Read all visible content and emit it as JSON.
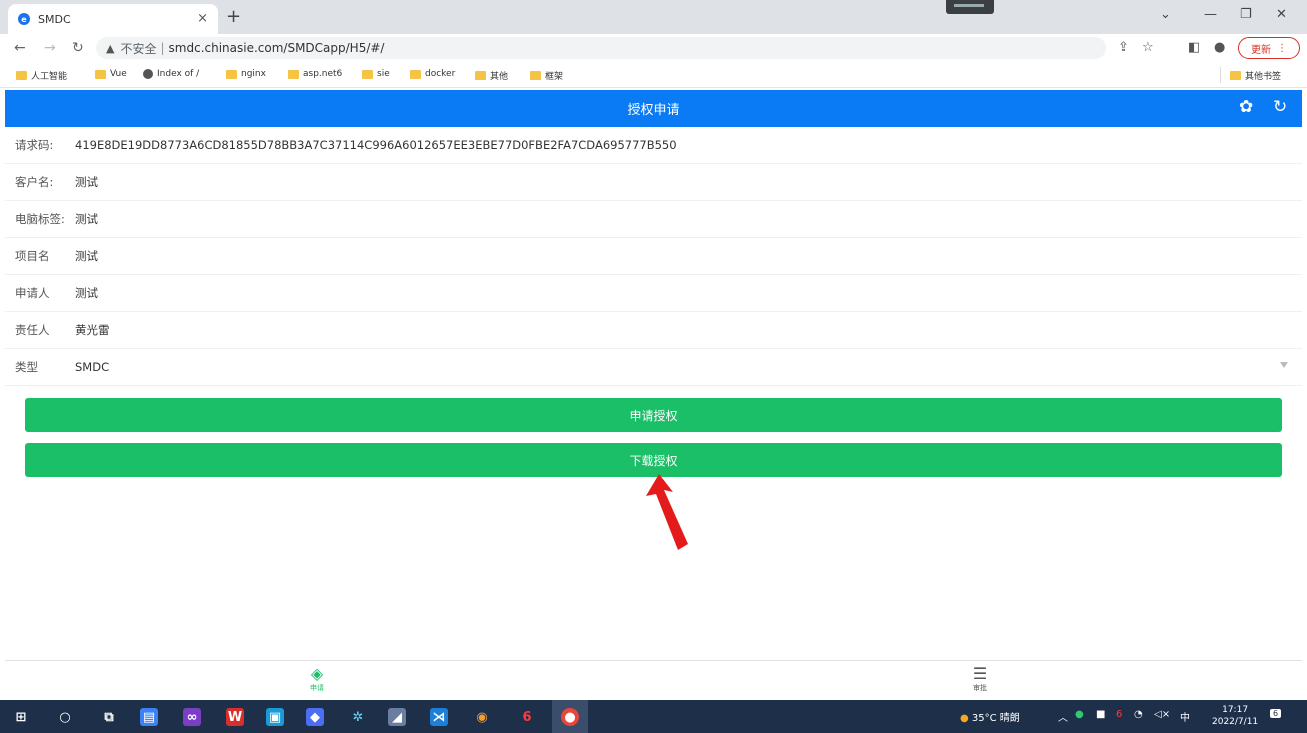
{
  "browser": {
    "tab_title": "SMDC",
    "tab_close": "×",
    "new_tab": "+",
    "win_minimize": "—",
    "win_restore": "❐",
    "win_close": "✕",
    "tab_list": "⌄",
    "insecure_label": "不安全",
    "url": "smdc.chinasie.com/SMDCapp/H5/#/",
    "update_label": "更新",
    "bookmarks": [
      "人工智能",
      "Vue",
      "Index of /",
      "nginx",
      "asp.net6",
      "sie",
      "docker",
      "其他",
      "框架"
    ],
    "other_bookmarks": "其他书签"
  },
  "app": {
    "header_title": "授权申请",
    "header_icons": [
      "flower-settings-icon",
      "refresh-icon"
    ],
    "fields": [
      {
        "label": "请求码:",
        "value": "419E8DE19DD8773A6CD81855D78BB3A7C37114C996A6012657EE3EBE77D0FBE2FA7CDA695777B550"
      },
      {
        "label": "客户名:",
        "value": "测试"
      },
      {
        "label": "电脑标签:",
        "value": "测试"
      },
      {
        "label": "项目名",
        "value": "测试"
      },
      {
        "label": "申请人",
        "value": "测试"
      },
      {
        "label": "责任人",
        "value": "黄光雷"
      },
      {
        "label": "类型",
        "value": "SMDC"
      }
    ],
    "apply_button": "申请授权",
    "download_button": "下载授权",
    "nav": [
      {
        "label": "申请",
        "icon": "layers-icon",
        "active": true
      },
      {
        "label": "审批",
        "icon": "list-icon",
        "active": false
      }
    ]
  },
  "taskbar": {
    "weather": "35°C 晴朗",
    "ime": "中",
    "time": "17:17",
    "date": "2022/7/11",
    "notification_count": "6"
  },
  "colors": {
    "header_blue": "#0a7af5",
    "button_green": "#1bbf67",
    "annotation_red": "#e41b1b",
    "taskbar": "#1e2f4a"
  }
}
